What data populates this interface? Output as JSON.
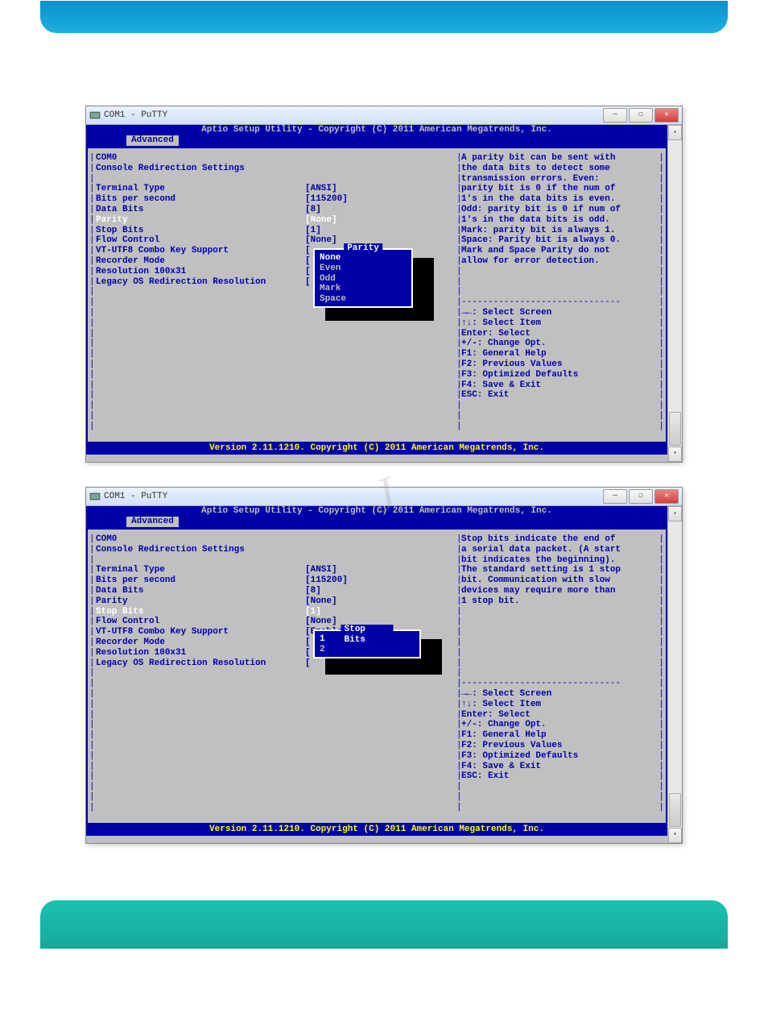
{
  "titlebar": {
    "text": "COM1 - PuTTY"
  },
  "bios": {
    "header": "Aptio Setup Utility - Copyright (C) 2011 American Megatrends, Inc.",
    "tab": "Advanced",
    "footer": "Version 2.11.1210. Copyright (C) 2011 American Megatrends, Inc."
  },
  "screen1": {
    "heading1": "COM0",
    "heading2": "Console Redirection Settings",
    "settings": [
      {
        "label": "Terminal Type",
        "value": "[ANSI]"
      },
      {
        "label": "Bits per second",
        "value": "[115200]"
      },
      {
        "label": "Data Bits",
        "value": "[8]"
      },
      {
        "label": "Parity",
        "value": "[None]",
        "selected": true
      },
      {
        "label": "Stop Bits",
        "value": "[1]"
      },
      {
        "label": "Flow Control",
        "value": "[None]"
      },
      {
        "label": "VT-UTF8 Combo Key Support",
        "value": "["
      },
      {
        "label": "Recorder Mode",
        "value": "["
      },
      {
        "label": "Resolution 100x31",
        "value": "["
      },
      {
        "label": "Legacy OS Redirection Resolution",
        "value": "["
      }
    ],
    "popup": {
      "title": " Parity ",
      "items": [
        "None",
        "Even",
        "Odd",
        "Mark",
        "Space"
      ],
      "selected": 0
    },
    "help": [
      "A parity bit can be sent with",
      "the data bits to detect some",
      "transmission errors. Even:",
      "parity bit is 0 if the num of",
      "1's in the data bits is even.",
      "Odd: parity bit is 0 if num of",
      "1's in the data bits is odd.",
      "Mark: parity bit is always 1.",
      "Space: Parity bit is always 0.",
      "Mark and Space Parity do not",
      "allow for error detection."
    ]
  },
  "screen2": {
    "heading1": "COM0",
    "heading2": "Console Redirection Settings",
    "settings": [
      {
        "label": "Terminal Type",
        "value": "[ANSI]"
      },
      {
        "label": "Bits per second",
        "value": "[115200]"
      },
      {
        "label": "Data Bits",
        "value": "[8]"
      },
      {
        "label": "Parity",
        "value": "[None]"
      },
      {
        "label": "Stop Bits",
        "value": "[1]",
        "selected": true
      },
      {
        "label": "Flow Control",
        "value": "[None]"
      },
      {
        "label": "VT-UTF8 Combo Key Support",
        "value": "[Enabled]"
      },
      {
        "label": "Recorder Mode",
        "value": "["
      },
      {
        "label": "Resolution 100x31",
        "value": "["
      },
      {
        "label": "Legacy OS Redirection Resolution",
        "value": "["
      }
    ],
    "popup": {
      "title": " Stop Bits ",
      "items": [
        "1",
        "2"
      ],
      "selected": 0
    },
    "help": [
      "Stop bits indicate the end of",
      "a serial data packet. (A start",
      "bit indicates the beginning).",
      "The standard setting is 1 stop",
      "bit. Communication with slow",
      "devices may require more than",
      "1 stop bit."
    ]
  },
  "navhelp": [
    "→←: Select Screen",
    "↑↓: Select Item",
    "Enter: Select",
    "+/-: Change Opt.",
    "F1: General Help",
    "F2: Previous Values",
    "F3: Optimized Defaults",
    "F4: Save & Exit",
    "ESC: Exit"
  ],
  "watermark": "J"
}
